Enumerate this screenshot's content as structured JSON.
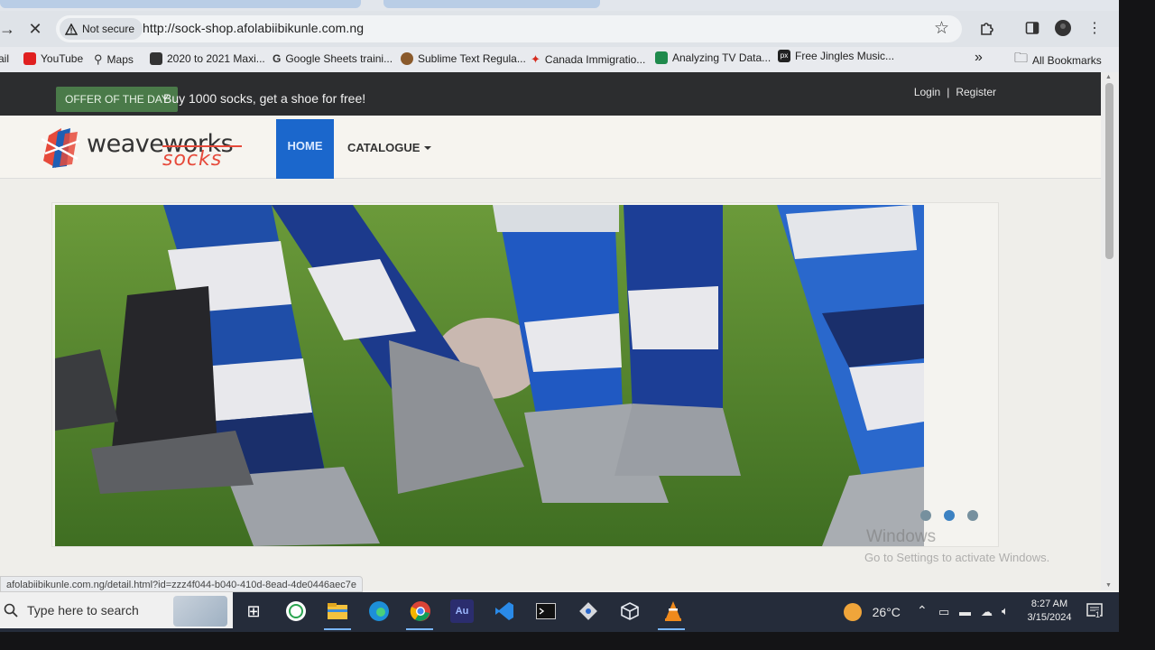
{
  "browser": {
    "security_label": "Not secure",
    "url": "http://sock-shop.afolabiibikunle.com.ng",
    "status_url": "afolabiibikunle.com.ng/detail.html?id=zzz4f044-b040-410d-8ead-4de0446aec7e"
  },
  "bookmarks": {
    "items": [
      {
        "label": "ail",
        "icon": "mail-icon"
      },
      {
        "label": "YouTube",
        "icon": "youtube-icon"
      },
      {
        "label": "Maps",
        "icon": "maps-pin-icon"
      },
      {
        "label": "2020 to 2021 Maxi...",
        "icon": "page-icon"
      },
      {
        "label": "Google Sheets traini...",
        "icon": "google-g-icon"
      },
      {
        "label": "Sublime Text Regula...",
        "icon": "sublime-icon"
      },
      {
        "label": "Canada Immigratio...",
        "icon": "maple-leaf-icon"
      },
      {
        "label": "Analyzing TV Data...",
        "icon": "data-icon"
      },
      {
        "label": "Free Jingles Music...",
        "icon": "px-icon"
      }
    ],
    "overflow": "»",
    "all_bookmarks": "All Bookmarks"
  },
  "site": {
    "offer_badge": "OFFER OF THE DAY",
    "offer_text": "Buy 1000 socks, get a shoe for free!",
    "login": "Login",
    "separator": "|",
    "register": "Register",
    "logo_main": "weaveworks",
    "logo_sub": "socks",
    "nav": {
      "home": "HOME",
      "catalogue": "CATALOGUE"
    },
    "carousel_dots": 3,
    "carousel_active": 2
  },
  "windows": {
    "watermark_title": "Windows",
    "watermark_sub": "Go to Settings to activate Windows.",
    "search_placeholder": "Type here to search",
    "temperature": "26°C",
    "time": "8:27 AM",
    "date": "3/15/2024",
    "notification_count": "1"
  },
  "colors": {
    "offer_green": "#4a7a49",
    "nav_active_blue": "#1b67cc",
    "dark_bar": "#2c2d2f"
  }
}
